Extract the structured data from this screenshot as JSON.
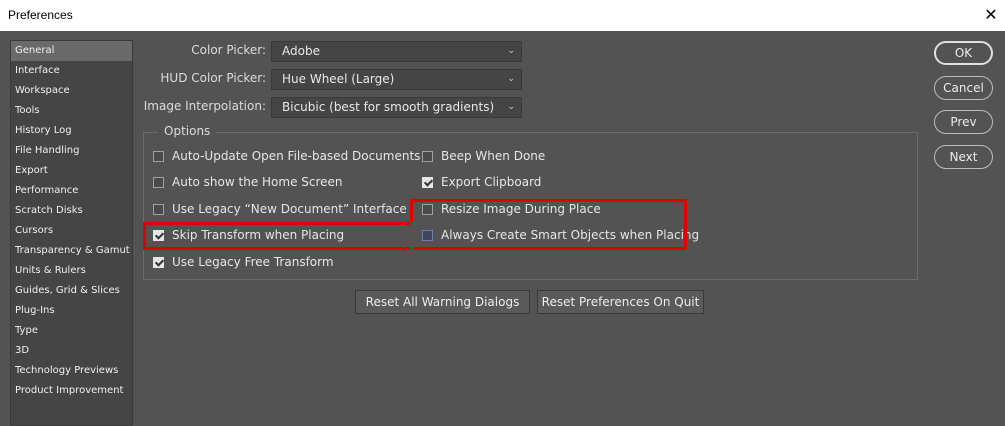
{
  "window": {
    "title": "Preferences",
    "close_glyph": "✕"
  },
  "sidebar": {
    "items": [
      {
        "label": "General",
        "selected": true
      },
      {
        "label": "Interface"
      },
      {
        "label": "Workspace"
      },
      {
        "label": "Tools"
      },
      {
        "label": "History Log"
      },
      {
        "label": "File Handling"
      },
      {
        "label": "Export"
      },
      {
        "label": "Performance"
      },
      {
        "label": "Scratch Disks"
      },
      {
        "label": "Cursors"
      },
      {
        "label": "Transparency & Gamut"
      },
      {
        "label": "Units & Rulers"
      },
      {
        "label": "Guides, Grid & Slices"
      },
      {
        "label": "Plug-Ins"
      },
      {
        "label": "Type"
      },
      {
        "label": "3D"
      },
      {
        "label": "Technology Previews"
      },
      {
        "label": "Product Improvement"
      }
    ]
  },
  "general": {
    "color_picker": {
      "label": "Color Picker:",
      "value": "Adobe"
    },
    "hud_color_picker": {
      "label": "HUD Color Picker:",
      "value": "Hue Wheel (Large)"
    },
    "image_interpolation": {
      "label": "Image Interpolation:",
      "value": "Bicubic (best for smooth gradients)"
    },
    "chevron": "⌄"
  },
  "options": {
    "legend": "Options",
    "left": [
      {
        "label": "Auto-Update Open File-based Documents",
        "checked": false
      },
      {
        "label": "Auto show the Home Screen",
        "checked": false
      },
      {
        "label": "Use Legacy “New Document” Interface",
        "checked": false
      },
      {
        "label": "Skip Transform when Placing",
        "checked": true
      },
      {
        "label": "Use Legacy Free Transform",
        "checked": true
      }
    ],
    "right": [
      {
        "label": "Beep When Done",
        "checked": false
      },
      {
        "label": "Export Clipboard",
        "checked": true
      },
      {
        "label": "Resize Image During Place",
        "checked": false
      },
      {
        "label": "Always Create Smart Objects when Placing",
        "checked": false
      }
    ]
  },
  "buttons": {
    "reset_warnings": "Reset All Warning Dialogs",
    "reset_prefs": "Reset Preferences On Quit",
    "ok": "OK",
    "cancel": "Cancel",
    "prev": "Prev",
    "next": "Next"
  },
  "colors": {
    "background": "#535353",
    "highlight": "#e10000"
  }
}
